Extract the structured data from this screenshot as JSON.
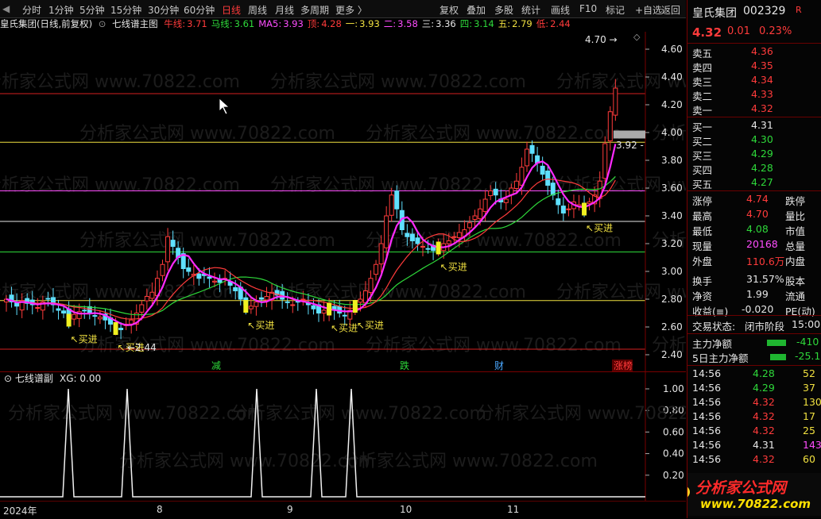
{
  "toolbar": {
    "items": [
      "分时",
      "1分钟",
      "5分钟",
      "15分钟",
      "30分钟",
      "60分钟",
      "日线",
      "周线",
      "月线",
      "多周期",
      "更多 〉"
    ],
    "active_index": 6,
    "right_items": [
      "复权",
      "叠加",
      "多股",
      "统计",
      "画线",
      "F10",
      "标记",
      "+自选",
      "返回"
    ]
  },
  "info": {
    "stock_label": "皇氏集团(日线,前复权)",
    "indicator_name": "七线谱主图",
    "ma": [
      {
        "label": "牛线:",
        "value": "3.71",
        "color": "#ff3b3b"
      },
      {
        "label": "马线:",
        "value": "3.61",
        "color": "#2ed83a"
      },
      {
        "label": "MA5:",
        "value": "3.93",
        "color": "#ff4dff"
      },
      {
        "label": "顶:",
        "value": "4.28",
        "color": "#ff3b3b"
      },
      {
        "label": "一:",
        "value": "3.93",
        "color": "#f0e040"
      },
      {
        "label": "二:",
        "value": "3.58",
        "color": "#ff4dff"
      },
      {
        "label": "三:",
        "value": "3.36",
        "color": "#e6e6e6"
      },
      {
        "label": "四:",
        "value": "3.14",
        "color": "#2ed83a"
      },
      {
        "label": "五:",
        "value": "2.79",
        "color": "#f0e040"
      },
      {
        "label": "低:",
        "value": "2.44",
        "color": "#ff3b3b"
      }
    ]
  },
  "main_chart": {
    "y_ticks": [
      "4.60",
      "4.40",
      "4.20",
      "4.00",
      "3.80",
      "3.60",
      "3.40",
      "3.20",
      "3.00",
      "2.80",
      "2.60",
      "2.40"
    ],
    "levels": [
      {
        "value": 4.28,
        "color": "#d42020"
      },
      {
        "value": 3.93,
        "color": "#f0e040"
      },
      {
        "value": 3.58,
        "color": "#ff4dff"
      },
      {
        "value": 3.36,
        "color": "#e6e6e6"
      },
      {
        "value": 3.14,
        "color": "#2ed83a"
      },
      {
        "value": 2.79,
        "color": "#f0e040"
      },
      {
        "value": 2.44,
        "color": "#d42020"
      }
    ],
    "high_label": "4.70",
    "low_label": "2.44",
    "current_tag": "3.92",
    "buy_label": "买进",
    "event_labels": [
      {
        "text": "减",
        "color": "#2ed83a"
      },
      {
        "text": "跌",
        "color": "#2ed83a"
      },
      {
        "text": "财",
        "color": "#4aa8ff"
      },
      {
        "text": "涨榜",
        "color": "#ff3b3b"
      }
    ],
    "watermark": "分析家公式网 www.70822.com"
  },
  "sub_chart": {
    "title": "七线谱副",
    "xg_label": "XG: 0.00",
    "y_ticks": [
      "1.00",
      "0.80",
      "0.60",
      "0.40",
      "0.20"
    ]
  },
  "x_axis": {
    "labels": [
      "2024年",
      "8",
      "9",
      "10",
      "11"
    ]
  },
  "quote": {
    "name": "皇氏集团",
    "code": "002329",
    "price": "4.32",
    "change": "0.01",
    "pct": "0.23%",
    "asks": [
      {
        "label": "卖五",
        "price": "4.36"
      },
      {
        "label": "卖四",
        "price": "4.35"
      },
      {
        "label": "卖三",
        "price": "4.34"
      },
      {
        "label": "卖二",
        "price": "4.33"
      },
      {
        "label": "卖一",
        "price": "4.32"
      }
    ],
    "bids": [
      {
        "label": "买一",
        "price": "4.31"
      },
      {
        "label": "买二",
        "price": "4.30"
      },
      {
        "label": "买三",
        "price": "4.29"
      },
      {
        "label": "买四",
        "price": "4.28"
      },
      {
        "label": "买五",
        "price": "4.27"
      }
    ],
    "stats": [
      {
        "l1": "涨停",
        "v1": "4.74",
        "c1": "red",
        "l2": "跌停"
      },
      {
        "l1": "最高",
        "v1": "4.70",
        "c1": "red",
        "l2": "量比"
      },
      {
        "l1": "最低",
        "v1": "4.08",
        "c1": "green",
        "l2": "市值"
      },
      {
        "l1": "现量",
        "v1": "20168",
        "c1": "magenta",
        "l2": "总量"
      },
      {
        "l1": "外盘",
        "v1": "110.6万",
        "c1": "red",
        "l2": "内盘"
      },
      {
        "l1": "换手",
        "v1": "31.57%",
        "c1": "white",
        "l2": "股本"
      },
      {
        "l1": "净资",
        "v1": "1.99",
        "c1": "white",
        "l2": "流通"
      },
      {
        "l1": "收益(≡)",
        "v1": "-0.020",
        "c1": "white",
        "l2": "PE(动)"
      }
    ],
    "trade_status_label": "交易状态:",
    "trade_status": "闭市阶段",
    "trade_time": "15:00",
    "main_flow_label": "主力净额",
    "main_flow": "-410",
    "main_flow5_label": "5日主力净额",
    "main_flow5": "-25.1",
    "ticks": [
      {
        "time": "14:56",
        "price": "4.28",
        "vol": "52",
        "c": "green"
      },
      {
        "time": "14:56",
        "price": "4.29",
        "vol": "37",
        "c": "green"
      },
      {
        "time": "14:56",
        "price": "4.32",
        "vol": "130",
        "c": "red"
      },
      {
        "time": "14:56",
        "price": "4.32",
        "vol": "17",
        "c": "red"
      },
      {
        "time": "14:56",
        "price": "4.32",
        "vol": "25",
        "c": "red"
      },
      {
        "time": "14:56",
        "price": "4.31",
        "vol": "143",
        "c": "white"
      },
      {
        "time": "14:56",
        "price": "4.32",
        "vol": "60",
        "c": "red"
      }
    ],
    "logo_text": "分析家公式网",
    "logo_url": "www.70822.com"
  }
}
